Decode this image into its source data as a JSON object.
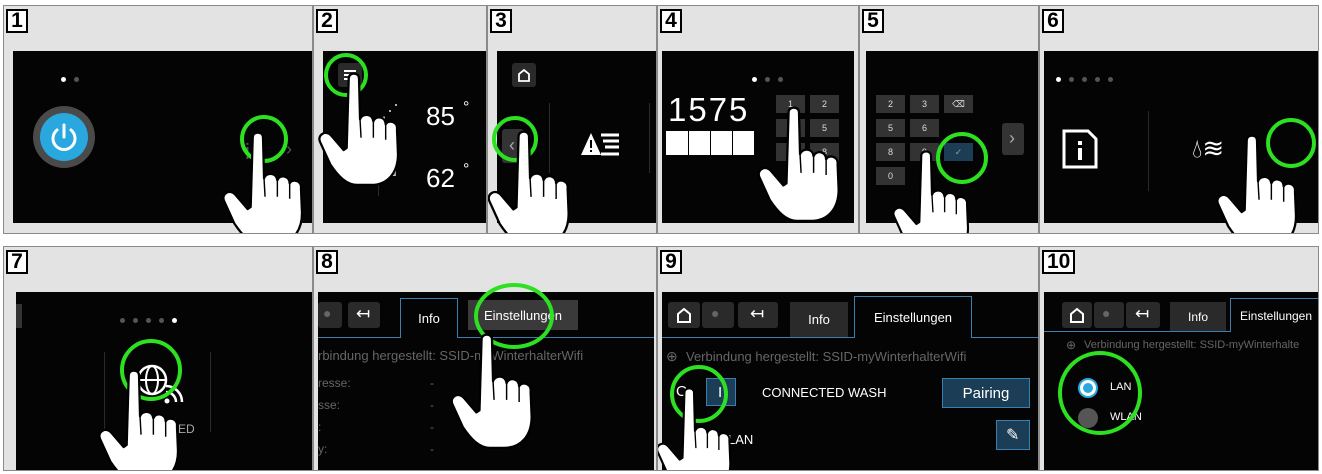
{
  "panels": [
    {
      "number": "1"
    },
    {
      "number": "2",
      "temp_top": "85",
      "temp_bottom": "62",
      "degree": "°"
    },
    {
      "number": "3"
    },
    {
      "number": "4",
      "pin_display": "1575",
      "keys": [
        "1",
        "2",
        "4",
        "5",
        "7",
        "8"
      ]
    },
    {
      "number": "5",
      "keys": [
        "2",
        "3",
        "5",
        "6",
        "8",
        "9",
        "0"
      ]
    },
    {
      "number": "6"
    },
    {
      "number": "7",
      "label": "CTED"
    },
    {
      "number": "8",
      "tab_info": "Info",
      "tab_settings": "Einstellungen",
      "status": "rbindung hergestellt: SSID-myWinterhalterWifi",
      "rows": [
        "resse:",
        "sse:",
        ":",
        "y:"
      ],
      "dash": "-"
    },
    {
      "number": "9",
      "tab_info": "Info",
      "tab_settings": "Einstellungen",
      "status": "Verbindung hergestellt: SSID-myWinterhalterWifi",
      "toggle_off": "O",
      "toggle_on": "I",
      "connected_wash": "CONNECTED WASH",
      "pairing": "Pairing",
      "lan": "LAN"
    },
    {
      "number": "10",
      "tab_info": "Info",
      "tab_settings": "Einstellungen",
      "status": "Verbindung hergestellt: SSID-myWinterhalte",
      "option_lan": "LAN",
      "option_wlan": "WLAN"
    }
  ],
  "colors": {
    "highlight_ring": "#2de022",
    "power_button": "#29a8e0",
    "tab_border": "#3a7fb0"
  }
}
